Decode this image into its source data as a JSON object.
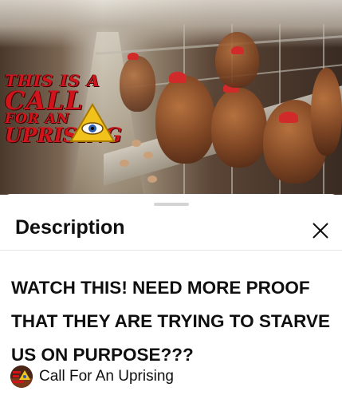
{
  "video": {
    "overlay_logo": {
      "line1": "THIS IS A",
      "line2": "CALL",
      "line3": "FOR AN",
      "line4": "UPRISING"
    }
  },
  "sheet": {
    "title": "Description",
    "close_icon": "close-icon",
    "description": "WATCH THIS! NEED MORE PROOF THAT THEY ARE TRYING TO STARVE US ON PURPOSE???",
    "channel": {
      "name": "Call For An Uprising",
      "avatar_icon": "channel-avatar"
    }
  },
  "colors": {
    "logo_red": "#d1141b",
    "text": "#0f0f0f",
    "divider": "#e5e5e5"
  }
}
